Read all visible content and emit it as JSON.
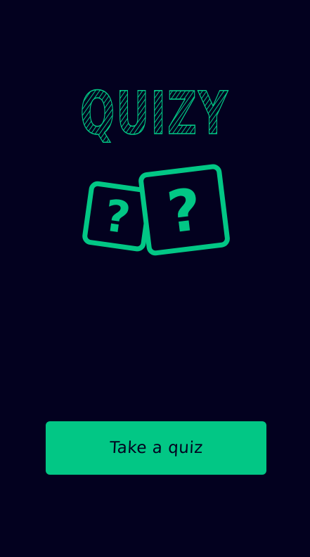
{
  "app": {
    "title": "QUIZY",
    "accent_color": "#02c785",
    "background_color": "#03011f"
  },
  "logo": {
    "icon_name": "two-question-cards-icon",
    "glyph": "?"
  },
  "actions": {
    "take_quiz_label": "Take a quiz"
  }
}
